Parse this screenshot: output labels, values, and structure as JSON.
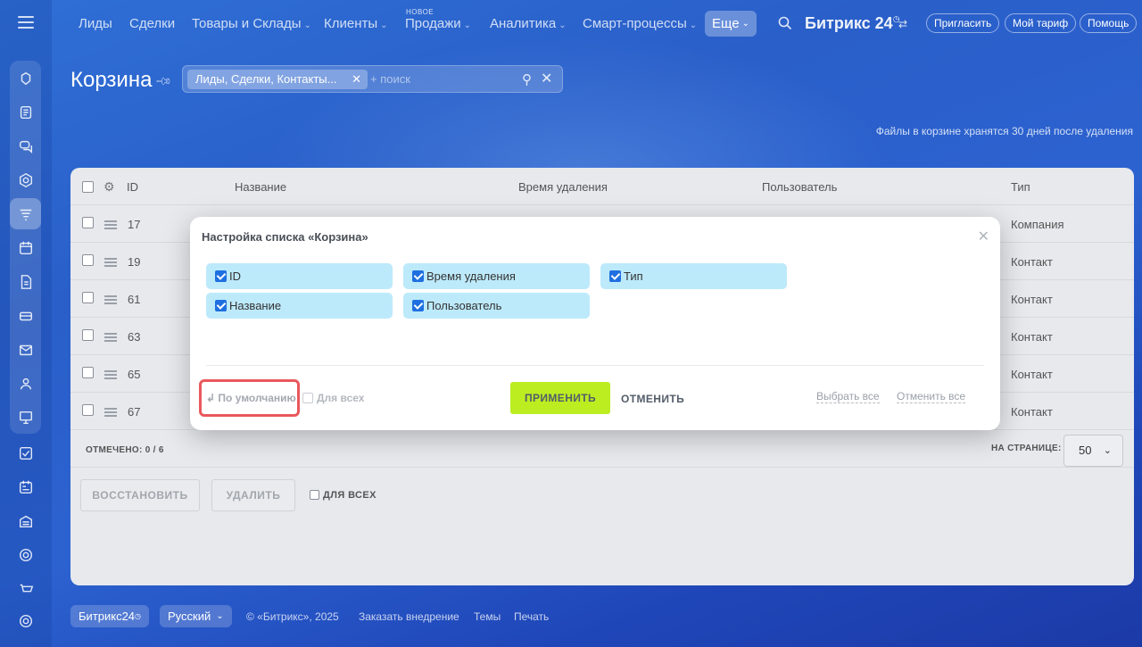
{
  "nav": {
    "items": [
      {
        "label": "Лиды",
        "chevron": false
      },
      {
        "label": "Сделки",
        "chevron": false
      },
      {
        "label": "Товары и Склады",
        "chevron": true
      },
      {
        "label": "Клиенты",
        "chevron": true
      },
      {
        "label": "Продажи",
        "chevron": true,
        "badge": "НОВОЕ"
      },
      {
        "label": "Аналитика",
        "chevron": true
      },
      {
        "label": "Смарт-процессы",
        "chevron": true
      }
    ],
    "more": "Еще",
    "brand": "Битрикс 24",
    "invite": "Пригласить",
    "tariff": "Мой тариф",
    "help": "Помощь"
  },
  "page": {
    "title": "Корзина",
    "filter_chip": "Лиды, Сделки, Контакты...",
    "search_placeholder": "+ поиск",
    "storage_note": "Файлы в корзине хранятся 30 дней после удаления"
  },
  "grid": {
    "headers": {
      "id": "ID",
      "name": "Название",
      "deleted_at": "Время удаления",
      "user": "Пользователь",
      "type": "Тип"
    },
    "rows": [
      {
        "id": "17",
        "type": "Компания"
      },
      {
        "id": "19",
        "type": "Контакт"
      },
      {
        "id": "61",
        "type": "Контакт"
      },
      {
        "id": "63",
        "type": "Контакт"
      },
      {
        "id": "65",
        "type": "Контакт"
      },
      {
        "id": "67",
        "type": "Контакт"
      }
    ],
    "marked_label": "ОТМЕЧЕНО:",
    "marked_value": "0 / 6",
    "per_page_label": "НА СТРАНИЦЕ:",
    "per_page_value": "50",
    "restore": "ВОССТАНОВИТЬ",
    "delete": "УДАЛИТЬ",
    "for_all": "ДЛЯ ВСЕХ"
  },
  "modal": {
    "title": "Настройка списка «Корзина»",
    "columns": [
      {
        "label": "ID",
        "checked": true
      },
      {
        "label": "Время удаления",
        "checked": true
      },
      {
        "label": "Тип",
        "checked": true
      },
      {
        "label": "Название",
        "checked": true
      },
      {
        "label": "Пользователь",
        "checked": true
      }
    ],
    "default_link": "По умолчанию",
    "for_all": "Для всех",
    "apply": "ПРИМЕНИТЬ",
    "cancel": "ОТМЕНИТЬ",
    "select_all": "Выбрать все",
    "deselect_all": "Отменить все"
  },
  "footer": {
    "brand": "Битрикс24",
    "language": "Русский",
    "copyright": "© «Битрикс», 2025",
    "order": "Заказать внедрение",
    "themes": "Темы",
    "print": "Печать"
  },
  "colors": {
    "accent_apply": "#bbed21",
    "column_chip": "#bdeafb",
    "highlight": "#e9585c"
  }
}
